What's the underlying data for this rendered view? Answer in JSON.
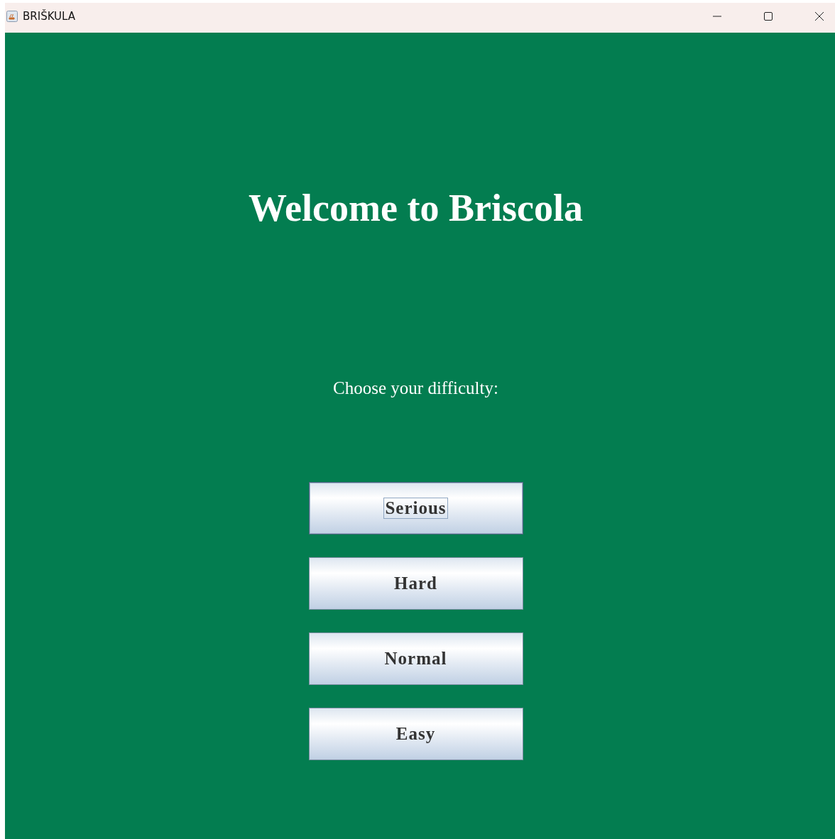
{
  "window": {
    "title": "BRIŠKULA"
  },
  "heading": "Welcome to Briscola",
  "prompt": "Choose your difficulty:",
  "buttons": [
    {
      "label": "Serious",
      "focused": true
    },
    {
      "label": "Hard",
      "focused": false
    },
    {
      "label": "Normal",
      "focused": false
    },
    {
      "label": "Easy",
      "focused": false
    }
  ]
}
